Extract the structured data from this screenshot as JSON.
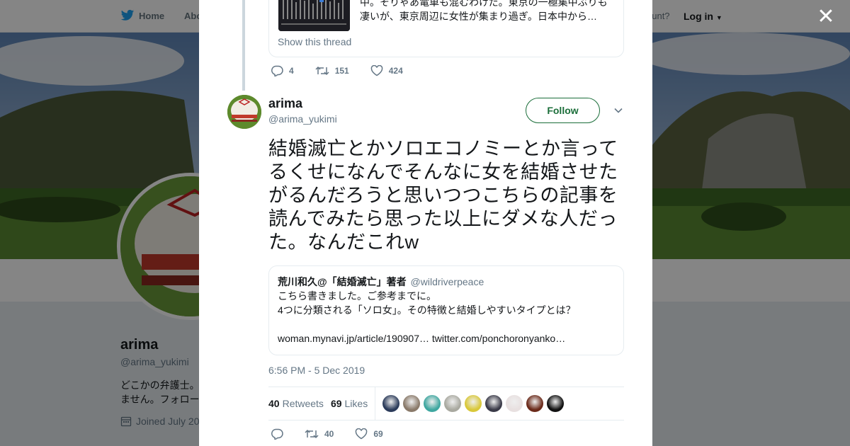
{
  "topnav": {
    "home_label": "Home",
    "about_label": "Abo",
    "account_prompt": "ccount?",
    "login_label": "Log in"
  },
  "profile": {
    "name": "arima",
    "handle": "@arima_yukimi",
    "bio_line1": "どこかの弁護士。",
    "bio_line2": "ません。フォロー",
    "joined": "Joined July 20"
  },
  "previous_tweet": {
    "quote_line1": "中。そりゃあ電車も混むわけだ。東京の一極集中ぶりも",
    "quote_line2": "凄いが、東京周辺に女性が集まり過ぎ。日本中から…",
    "show_thread": "Show this thread",
    "replies": "4",
    "retweets": "151",
    "likes": "424"
  },
  "tweet": {
    "author_name": "arima",
    "author_handle": "@arima_yukimi",
    "follow_label": "Follow",
    "text": "結婚滅亡とかソロエコノミーとか言ってるくせになんでそんなに女を結婚させたがるんだろうと思いつつこちらの記事を読んでみたら思った以上にダメな人だった。なんだこれw",
    "quoted": {
      "name": "荒川和久@「結婚滅亡」著者",
      "handle": "@wildriverpeace",
      "line1": "こちら書きました。ご参考までに。",
      "line2": "4つに分類される「ソロ女」。その特徴と結婚しやすいタイプとは？",
      "line3": "woman.mynavi.jp/article/190907… twitter.com/ponchoronyanko…"
    },
    "timestamp": "6:56 PM - 5 Dec 2019",
    "retweet_count": "40",
    "retweet_label": "Retweets",
    "like_count": "69",
    "like_label": "Likes",
    "action_retweets": "40",
    "action_likes": "69"
  },
  "likers": [
    {
      "icon": "liker-avatar-1",
      "color": "#2b3b5a"
    },
    {
      "icon": "liker-avatar-2",
      "color": "#8a7a6a"
    },
    {
      "icon": "liker-avatar-3",
      "color": "#3fa7a0"
    },
    {
      "icon": "liker-avatar-4",
      "color": "#a9a9a0"
    },
    {
      "icon": "liker-avatar-5",
      "color": "#d9c83a"
    },
    {
      "icon": "liker-avatar-6",
      "color": "#3a3a48"
    },
    {
      "icon": "liker-avatar-7",
      "color": "#e8e0e0"
    },
    {
      "icon": "liker-avatar-8",
      "color": "#6b2a1a"
    },
    {
      "icon": "liker-avatar-9",
      "color": "#111111"
    }
  ],
  "colors": {
    "follow_green": "#1b6e3a",
    "muted_text": "#657786",
    "border": "#e6ecf0"
  }
}
